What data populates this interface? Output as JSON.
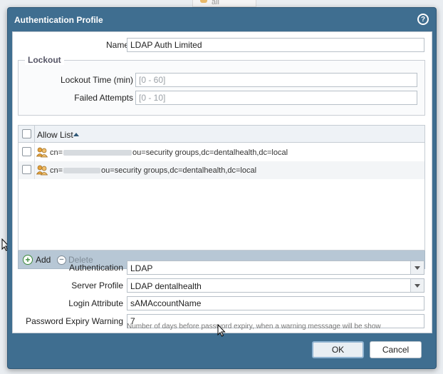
{
  "background": {
    "strip_text": "all"
  },
  "dialog": {
    "title": "Authentication Profile",
    "help_glyph": "?",
    "name": {
      "label": "Name",
      "value": "LDAP Auth Limited"
    },
    "lockout": {
      "legend": "Lockout",
      "lockout_time": {
        "label": "Lockout Time (min)",
        "placeholder": "[0 - 60]"
      },
      "failed_attempts": {
        "label": "Failed Attempts",
        "placeholder": "[0 - 10]"
      }
    },
    "allow_list": {
      "header": "Allow List",
      "rows": [
        {
          "prefix": "cn=",
          "suffix": "ou=security groups,dc=dentalhealth,dc=local"
        },
        {
          "prefix": "cn=",
          "suffix": "ou=security groups,dc=dentalhealth,dc=local"
        }
      ],
      "add_label": "Add",
      "delete_label": "Delete"
    },
    "authentication": {
      "label": "Authentication",
      "value": "LDAP"
    },
    "server_profile": {
      "label": "Server Profile",
      "value": "LDAP dentalhealth"
    },
    "login_attribute": {
      "label": "Login Attribute",
      "value": "sAMAccountName"
    },
    "password_expiry": {
      "label": "Password Expiry Warning",
      "value": "7",
      "hint": "Number of days before password expiry, when a warning messsage will be show"
    },
    "buttons": {
      "ok": "OK",
      "cancel": "Cancel"
    }
  },
  "colors": {
    "title_bar": "#3f6e90",
    "footer_bar": "#b7c7d5",
    "add_green": "#3c8a3c"
  }
}
